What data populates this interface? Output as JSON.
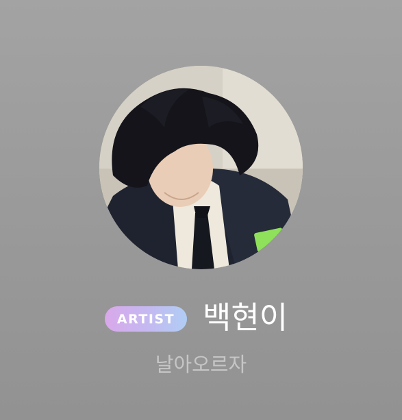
{
  "profile": {
    "badge_label": "ARTIST",
    "name": "백현이",
    "subtitle": "날아오르자"
  },
  "colors": {
    "background": "#9c9c9c",
    "badge_gradient_start": "#d9a8ea",
    "badge_gradient_end": "#b0cdf4",
    "name_text": "#ffffff",
    "subtitle_text": "#c6c6c6"
  },
  "icons": {
    "avatar": "profile-photo"
  }
}
